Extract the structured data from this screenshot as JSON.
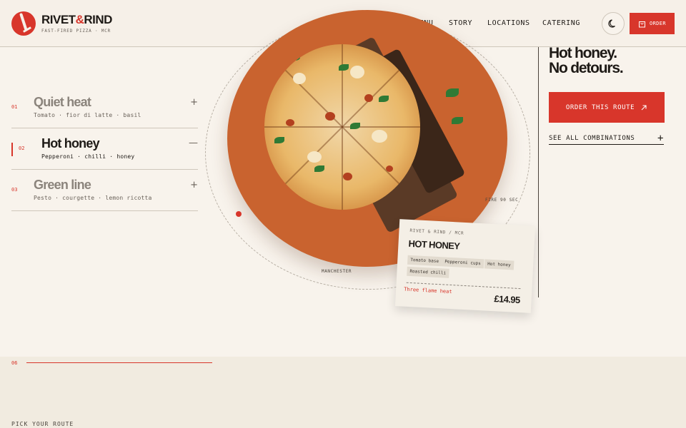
{
  "brand": {
    "name_a": "RIVET",
    "name_amp": "&",
    "name_b": "RIND",
    "tagline": "FAST-FIRED PIZZA · MCR"
  },
  "nav": {
    "items": [
      "MENU",
      "STORY",
      "LOCATIONS",
      "CATERING"
    ],
    "order_label": "ORDER"
  },
  "menu": [
    {
      "num": "01",
      "title": "Quiet heat",
      "sub": "Tomato · fior di latte · basil",
      "toggle": "+"
    },
    {
      "num": "02",
      "title": "Hot honey",
      "sub": "Pepperoni · chilli · honey",
      "toggle": "—"
    },
    {
      "num": "03",
      "title": "Green line",
      "sub": "Pesto · courgette · lemon ricotta",
      "toggle": "+"
    }
  ],
  "orbit": {
    "label_fire": "FIRE 90 SEC",
    "label_city": "MANCHESTER"
  },
  "ticket": {
    "header": "RIVET & RIND / MCR",
    "title": "HOT HONEY",
    "chips": [
      "Tomato base",
      "Pepperoni cups",
      "Hot honey",
      "Roasted chilli"
    ],
    "note": "Three flame heat",
    "price": "£14.95"
  },
  "hero": {
    "line1": "Hot honey.",
    "line2": "No detours.",
    "cta": "ORDER THIS ROUTE",
    "see_all": "SEE ALL COMBINATIONS",
    "see_all_icon": "+"
  },
  "section": {
    "num": "06",
    "label": "PICK YOUR ROUTE"
  },
  "colors": {
    "accent": "#d8362b",
    "background": "#f8f3ec",
    "plate": "#c9632f"
  }
}
